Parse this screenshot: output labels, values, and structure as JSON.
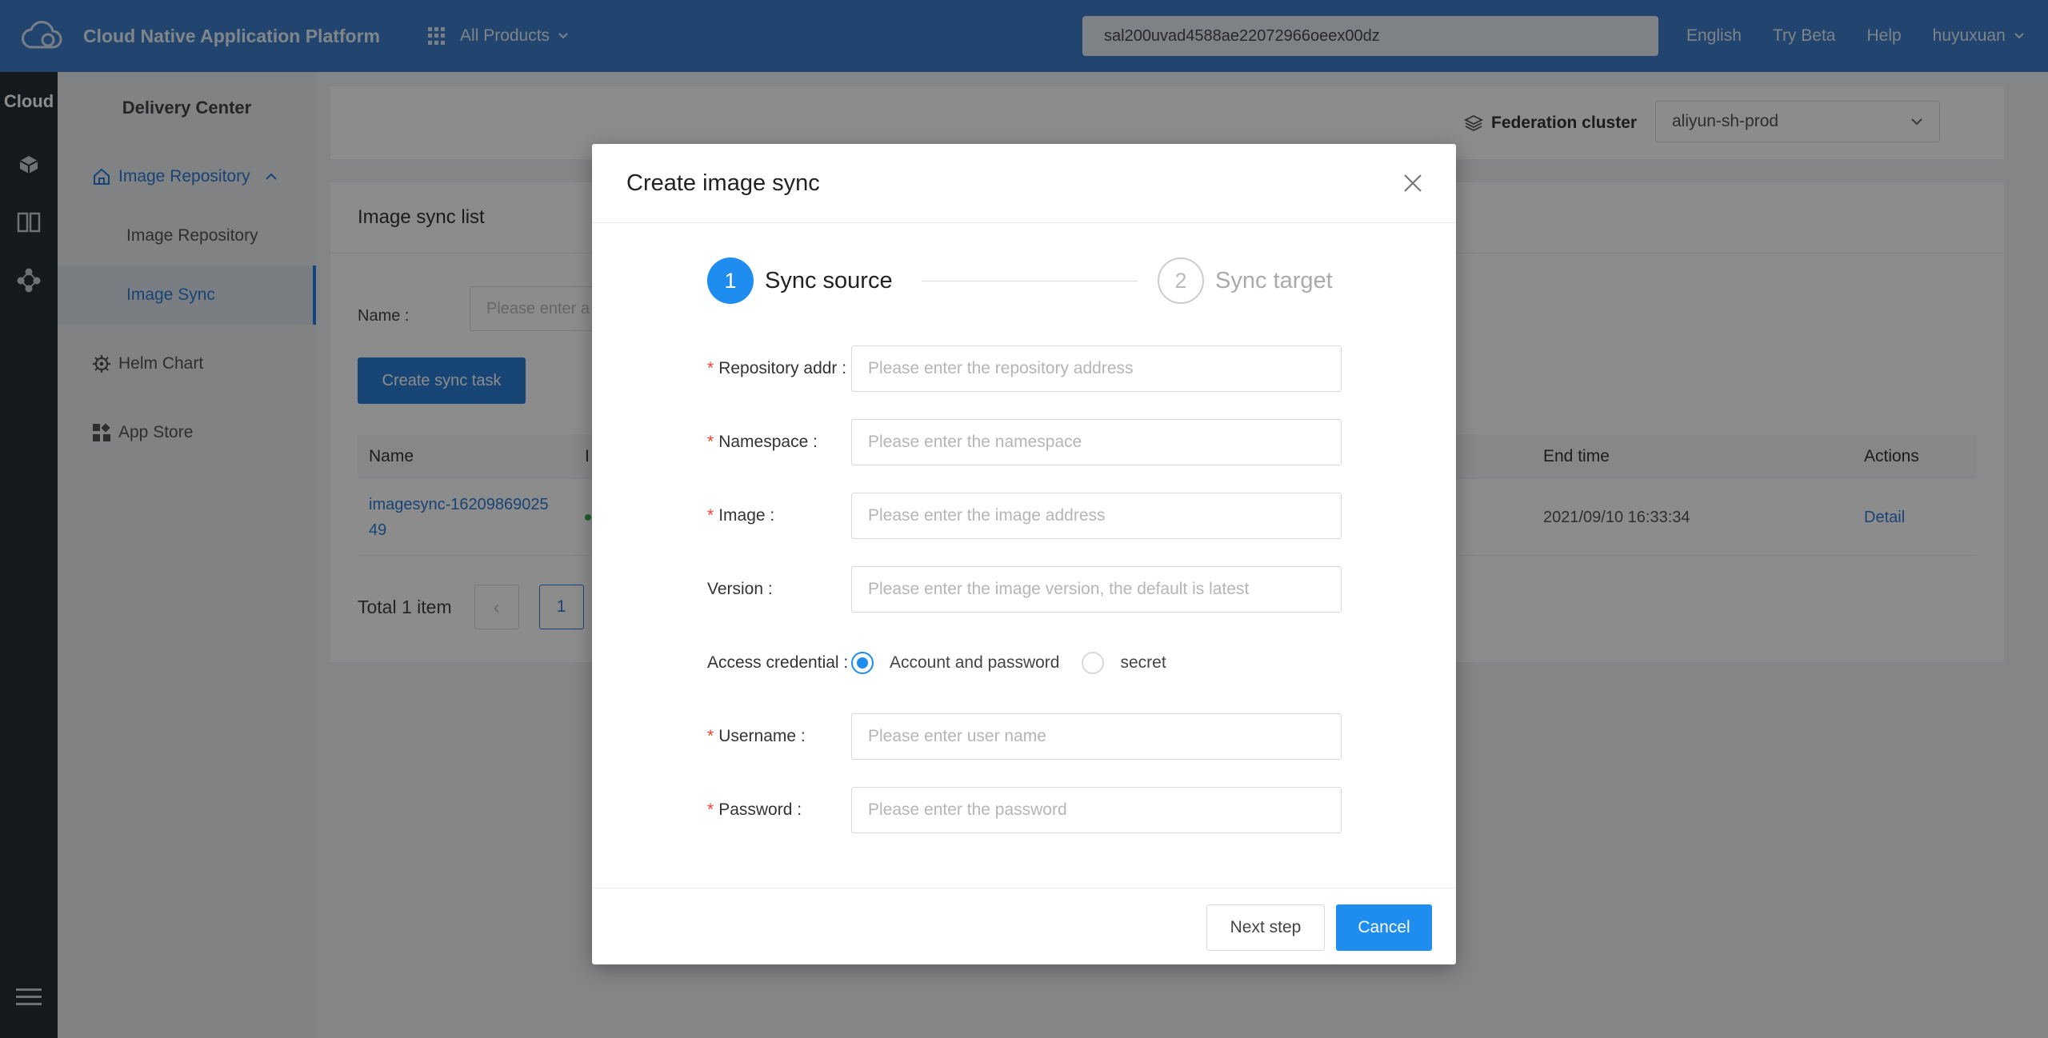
{
  "topbar": {
    "logo_icon": "cloud-logo-icon",
    "app_title": "Cloud Native Application Platform",
    "all_products": "All Products",
    "search_value": "sal200uvad4588ae22072966oeex00dz",
    "language": "English",
    "try_beta": "Try Beta",
    "help": "Help",
    "user": "huyuxuan"
  },
  "rail": {
    "title": "Cloud",
    "icons": [
      "cube-icon",
      "columns-icon",
      "nodes-icon",
      "menu-icon"
    ]
  },
  "sidebar": {
    "title": "Delivery Center",
    "items": [
      {
        "label": "Image Repository",
        "icon": "house-icon"
      },
      {
        "label": "Image Repository"
      },
      {
        "label": "Image Sync"
      },
      {
        "label": "Helm Chart",
        "icon": "helm-icon"
      },
      {
        "label": "App Store",
        "icon": "apps-icon"
      }
    ]
  },
  "main": {
    "federation_label": "Federation cluster",
    "federation_value": "aliyun-sh-prod",
    "list_title": "Image sync list",
    "name_label": "Name :",
    "name_placeholder": "Please enter a",
    "create_button": "Create sync task",
    "columns": {
      "name": "Name",
      "b": "I",
      "end_time": "End time",
      "actions": "Actions"
    },
    "row": {
      "name_line1": "imagesync-16209869025",
      "name_line2": "49",
      "end_time": "2021/09/10 16:33:34",
      "action": "Detail"
    },
    "total": "Total 1 item",
    "prev": "‹",
    "page": "1"
  },
  "modal": {
    "title": "Create image sync",
    "steps": [
      {
        "number": "1",
        "label": "Sync source"
      },
      {
        "number": "2",
        "label": "Sync target"
      }
    ],
    "fields": {
      "repo_label": "Repository addr :",
      "repo_placeholder": "Please enter the repository address",
      "namespace_label": "Namespace :",
      "namespace_placeholder": "Please enter the namespace",
      "image_label": "Image :",
      "image_placeholder": "Please enter the image address",
      "version_label": "Version :",
      "version_placeholder": "Please enter the image version, the default is latest",
      "credential_label": "Access credential :",
      "credential_option1": "Account and password",
      "credential_option2": "secret",
      "username_label": "Username :",
      "username_placeholder": "Please enter user name",
      "password_label": "Password :",
      "password_placeholder": "Please enter the password"
    },
    "required_mark": "*",
    "next_button": "Next step",
    "cancel_button": "Cancel"
  },
  "colors": {
    "topbar": "#3d7fc8",
    "primary": "#1f8cf0",
    "rail": "#262e38",
    "required": "#f04134"
  }
}
